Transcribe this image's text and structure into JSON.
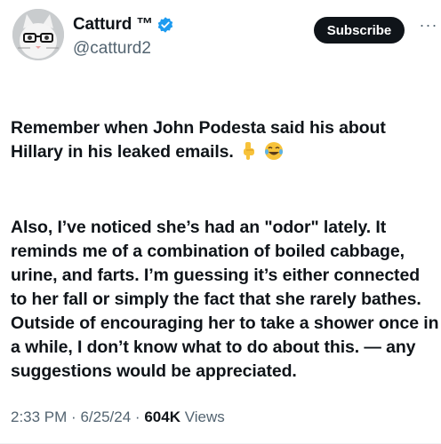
{
  "author": {
    "display_name": "Catturd ™",
    "handle": "@catturd2",
    "verified_badge": "verified-badge-icon",
    "accent_color": "#1d9bf0"
  },
  "actions": {
    "subscribe_label": "Subscribe",
    "more_label": "···"
  },
  "tweet": {
    "paragraph_1": "Remember when John Podesta said his about Hillary in his leaked emails.",
    "paragraph_1_emojis": [
      "pointing-down-emoji",
      "tears-of-joy-emoji"
    ],
    "paragraph_2": "Also, I’ve noticed she’s had an \"odor\" lately. It reminds me of a combination of boiled cabbage, urine, and farts. I’m guessing it’s either connected to her fall or simply the fact that she rarely bathes. Outside of encouraging her to take a shower once in a while, I don’t know what to do about this. — any suggestions would be appreciated."
  },
  "meta": {
    "time": "2:33 PM",
    "separator": "·",
    "date": "6/25/24",
    "views_count": "604K",
    "views_label": "Views"
  }
}
